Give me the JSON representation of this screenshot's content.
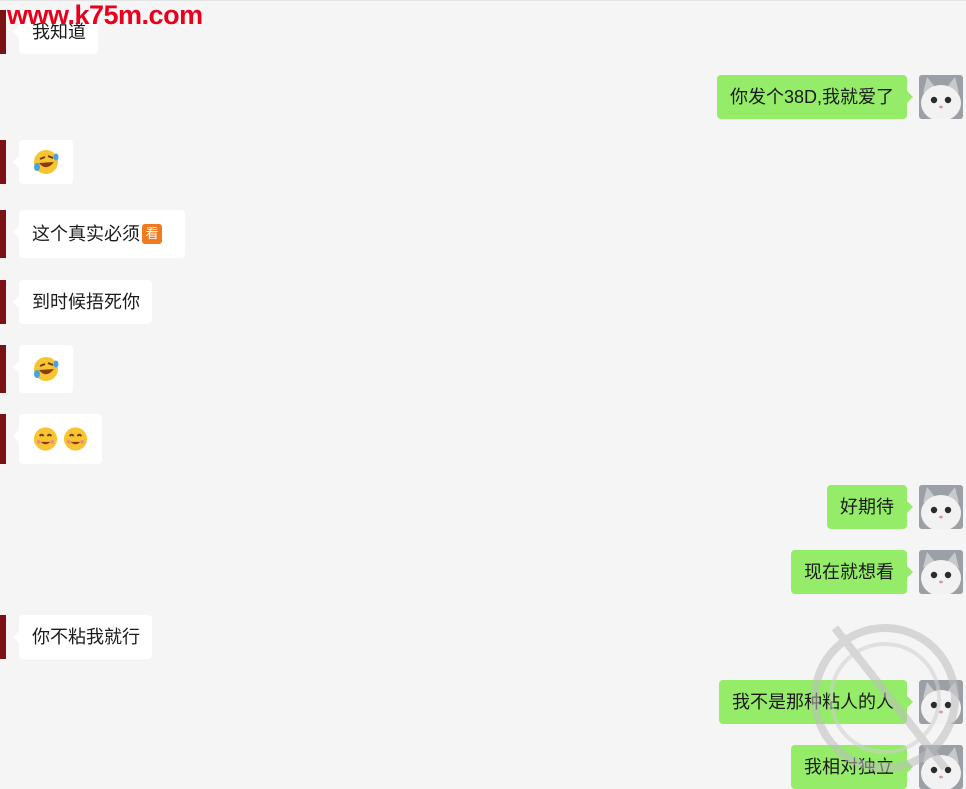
{
  "site_watermark": "www.k75m.com",
  "colors": {
    "incoming_bubble": "#ffffff",
    "outgoing_bubble": "#95ec69",
    "background": "#f5f5f5",
    "left_marker": "#7a1115"
  },
  "messages": [
    {
      "dir": "in",
      "text": "我知道"
    },
    {
      "dir": "out",
      "text": "你发个38D,我就爱了"
    },
    {
      "dir": "in",
      "emoji": [
        "rofl-emoji"
      ]
    },
    {
      "dir": "in",
      "text": "这个真实必须",
      "badge": "看"
    },
    {
      "dir": "in",
      "text": "到时候捂死你"
    },
    {
      "dir": "in",
      "emoji": [
        "rofl-emoji"
      ]
    },
    {
      "dir": "in",
      "emoji": [
        "drool-emoji",
        "drool-emoji"
      ]
    },
    {
      "dir": "out",
      "text": "好期待"
    },
    {
      "dir": "out",
      "text": "现在就想看"
    },
    {
      "dir": "in",
      "text": "你不粘我就行"
    },
    {
      "dir": "out",
      "text": "我不是那种粘人的人"
    },
    {
      "dir": "out",
      "text": "我相对独立"
    }
  ]
}
